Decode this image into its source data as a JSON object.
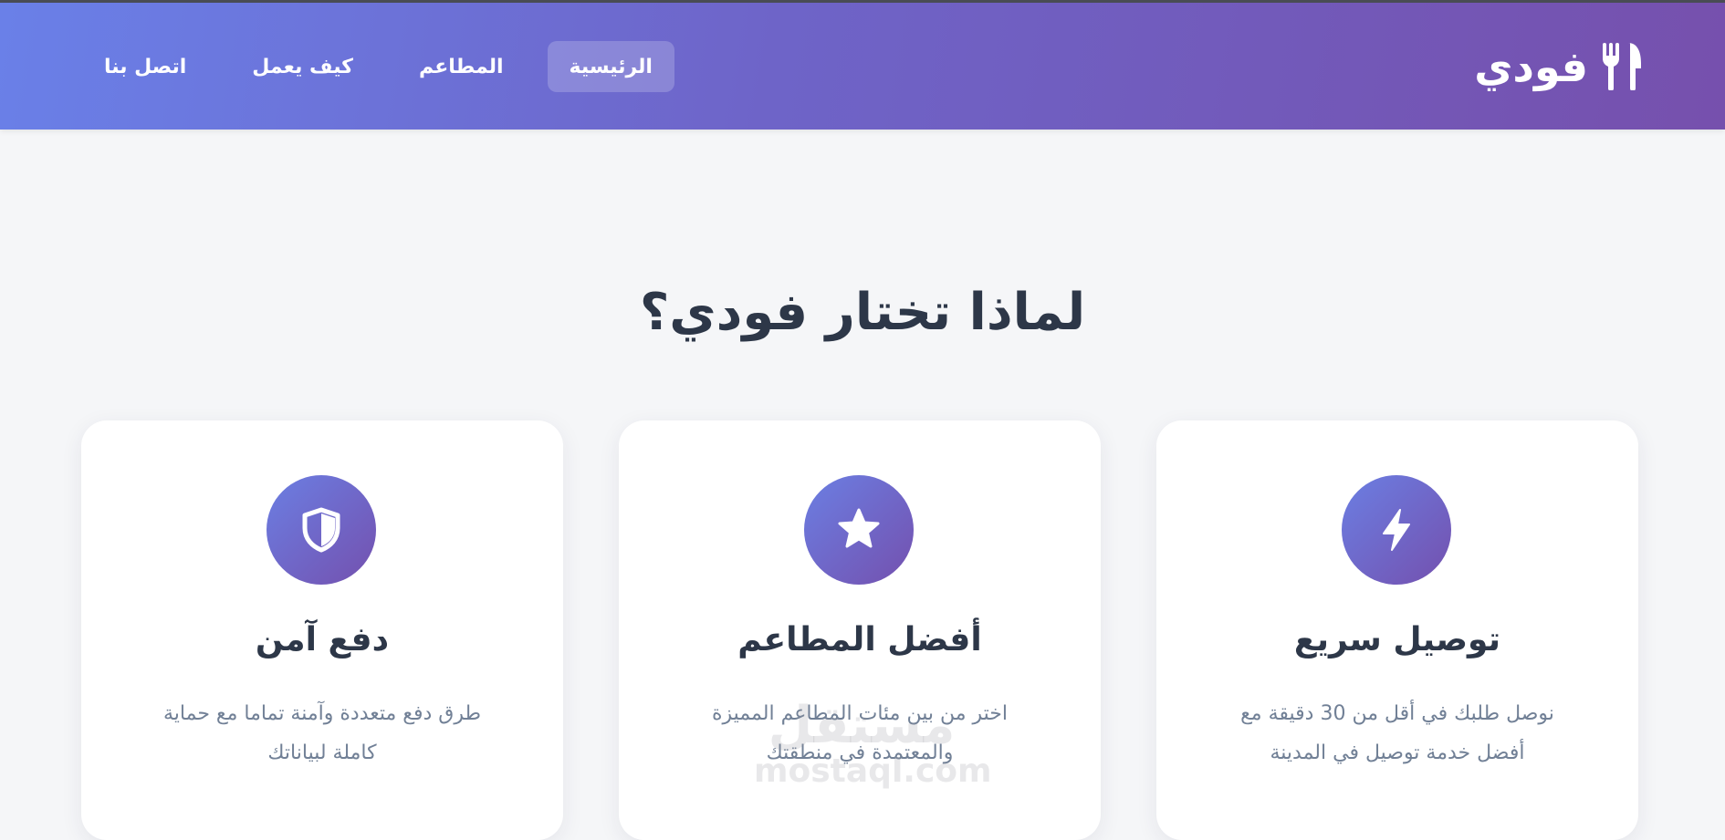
{
  "brand": {
    "name": "فودي",
    "icon": "fork-knife-icon"
  },
  "nav": {
    "items": [
      {
        "label": "الرئيسية",
        "active": true
      },
      {
        "label": "المطاعم",
        "active": false
      },
      {
        "label": "كيف يعمل",
        "active": false
      },
      {
        "label": "اتصل بنا",
        "active": false
      }
    ]
  },
  "section": {
    "title": "لماذا تختار فودي؟"
  },
  "features": [
    {
      "icon": "lightning-bolt-icon",
      "title": "توصيل سريع",
      "desc_line1": "نوصل طلبك في أقل من 30 دقيقة مع",
      "desc_line2": "أفضل خدمة توصيل في المدينة"
    },
    {
      "icon": "star-icon",
      "title": "أفضل المطاعم",
      "desc_line1": "اختر من بين مئات المطاعم المميزة",
      "desc_line2": "والمعتمدة في منطقتك"
    },
    {
      "icon": "shield-icon",
      "title": "دفع آمن",
      "desc_line1": "طرق دفع متعددة وآمنة تماما مع حماية",
      "desc_line2": "كاملة لبياناتك"
    }
  ],
  "watermark": {
    "arabic": "مستقل",
    "latin": "mostaql.com"
  },
  "colors": {
    "gradient_start": "#6a80e8",
    "gradient_end": "#7650ad",
    "heading": "#2d3748",
    "body_text": "#718096"
  }
}
